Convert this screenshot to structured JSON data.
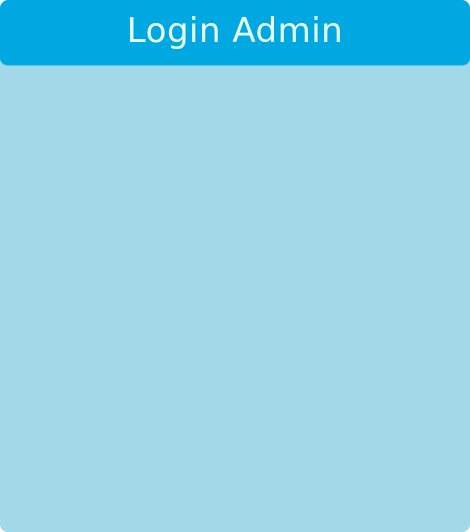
{
  "login_panel": {
    "header": {
      "title": "Login Admin"
    }
  },
  "colors": {
    "header_background": "#00a8e2",
    "panel_background": "#a1d9e9",
    "title_text": "#eaffff"
  }
}
